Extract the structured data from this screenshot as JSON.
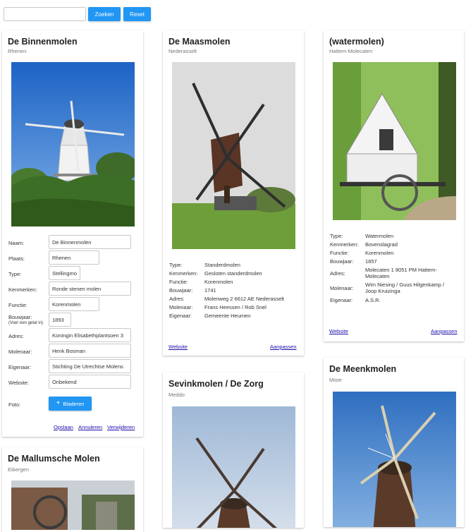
{
  "search": {
    "value": "",
    "placeholder": ""
  },
  "toolbar": {
    "search_label": "Zoeken",
    "reset_label": "Reset"
  },
  "field_labels": {
    "naam": "Naam:",
    "plaats": "Plaats:",
    "type": "Type:",
    "kenmerken": "Kenmerken:",
    "functie": "Functie:",
    "bouwjaar": "Bouwjaar:",
    "bouwjaar_hint": "(Voer een getal in)",
    "adres": "Adres:",
    "molenaar": "Molenaar:",
    "eigenaar": "Eigenaar:",
    "website": "Website:",
    "foto": "Foto:"
  },
  "edit_card": {
    "title": "De Binnenmolen",
    "subtitle": "Rhenen",
    "fields": {
      "naam": "De Binnenmolen",
      "plaats": "Rhenen",
      "type": "Stellingmolen",
      "kenmerken": "Ronde stenen molen",
      "functie": "Korenmolen",
      "bouwjaar": "1893",
      "adres": "Koningin Elisabethplantsoen 3",
      "molenaar": "Henk Bosman",
      "eigenaar": "Stichting De Utrechtse Molens",
      "website": "Onbekend"
    },
    "upload_label": "Bladeren",
    "actions": {
      "save": "Opslaan",
      "cancel": "Annuleren",
      "delete": "Verwijderen"
    }
  },
  "cards": [
    {
      "title": "De Maasmolen",
      "subtitle": "Nederasselt",
      "info": [
        {
          "key": "Type:",
          "value": "Standerdmolen"
        },
        {
          "key": "Kenmerken:",
          "value": "Gesloten standerdmolen"
        },
        {
          "key": "Functie:",
          "value": "Korenmolen"
        },
        {
          "key": "Bouwjaar:",
          "value": "1741"
        },
        {
          "key": "Adres:",
          "value": "Molenweg 2 6612 AE Nederasselt"
        },
        {
          "key": "Molenaar:",
          "value": "Frans Heessen / Rob Snel"
        },
        {
          "key": "Eigenaar:",
          "value": "Gemeente Heumen"
        }
      ],
      "website_label": "Website",
      "edit_label": "Aanpassen"
    },
    {
      "title": "(watermolen)",
      "subtitle": "Hattem-Molecaten",
      "info": [
        {
          "key": "Type:",
          "value": "Watermolen"
        },
        {
          "key": "Kenmerken:",
          "value": "Bovenslagrad"
        },
        {
          "key": "Functie:",
          "value": "Korenmolen"
        },
        {
          "key": "Bouwjaar:",
          "value": "1857"
        },
        {
          "key": "Adres:",
          "value": "Molecaten 1 8051 PM Hattem-Molecaten"
        },
        {
          "key": "Molenaar:",
          "value": "Wim Niesing / Guus Hilgenkamp / Joop Kruizinga"
        },
        {
          "key": "Eigenaar:",
          "value": "A.S.R."
        }
      ],
      "website_label": "Website",
      "edit_label": "Aanpassen"
    },
    {
      "title": "Sevinkmolen / De Zorg",
      "subtitle": "Meddo"
    },
    {
      "title": "De Meenkmolen",
      "subtitle": "Miste"
    },
    {
      "title": "De Mallumsche Molen",
      "subtitle": "Eibergen"
    }
  ]
}
